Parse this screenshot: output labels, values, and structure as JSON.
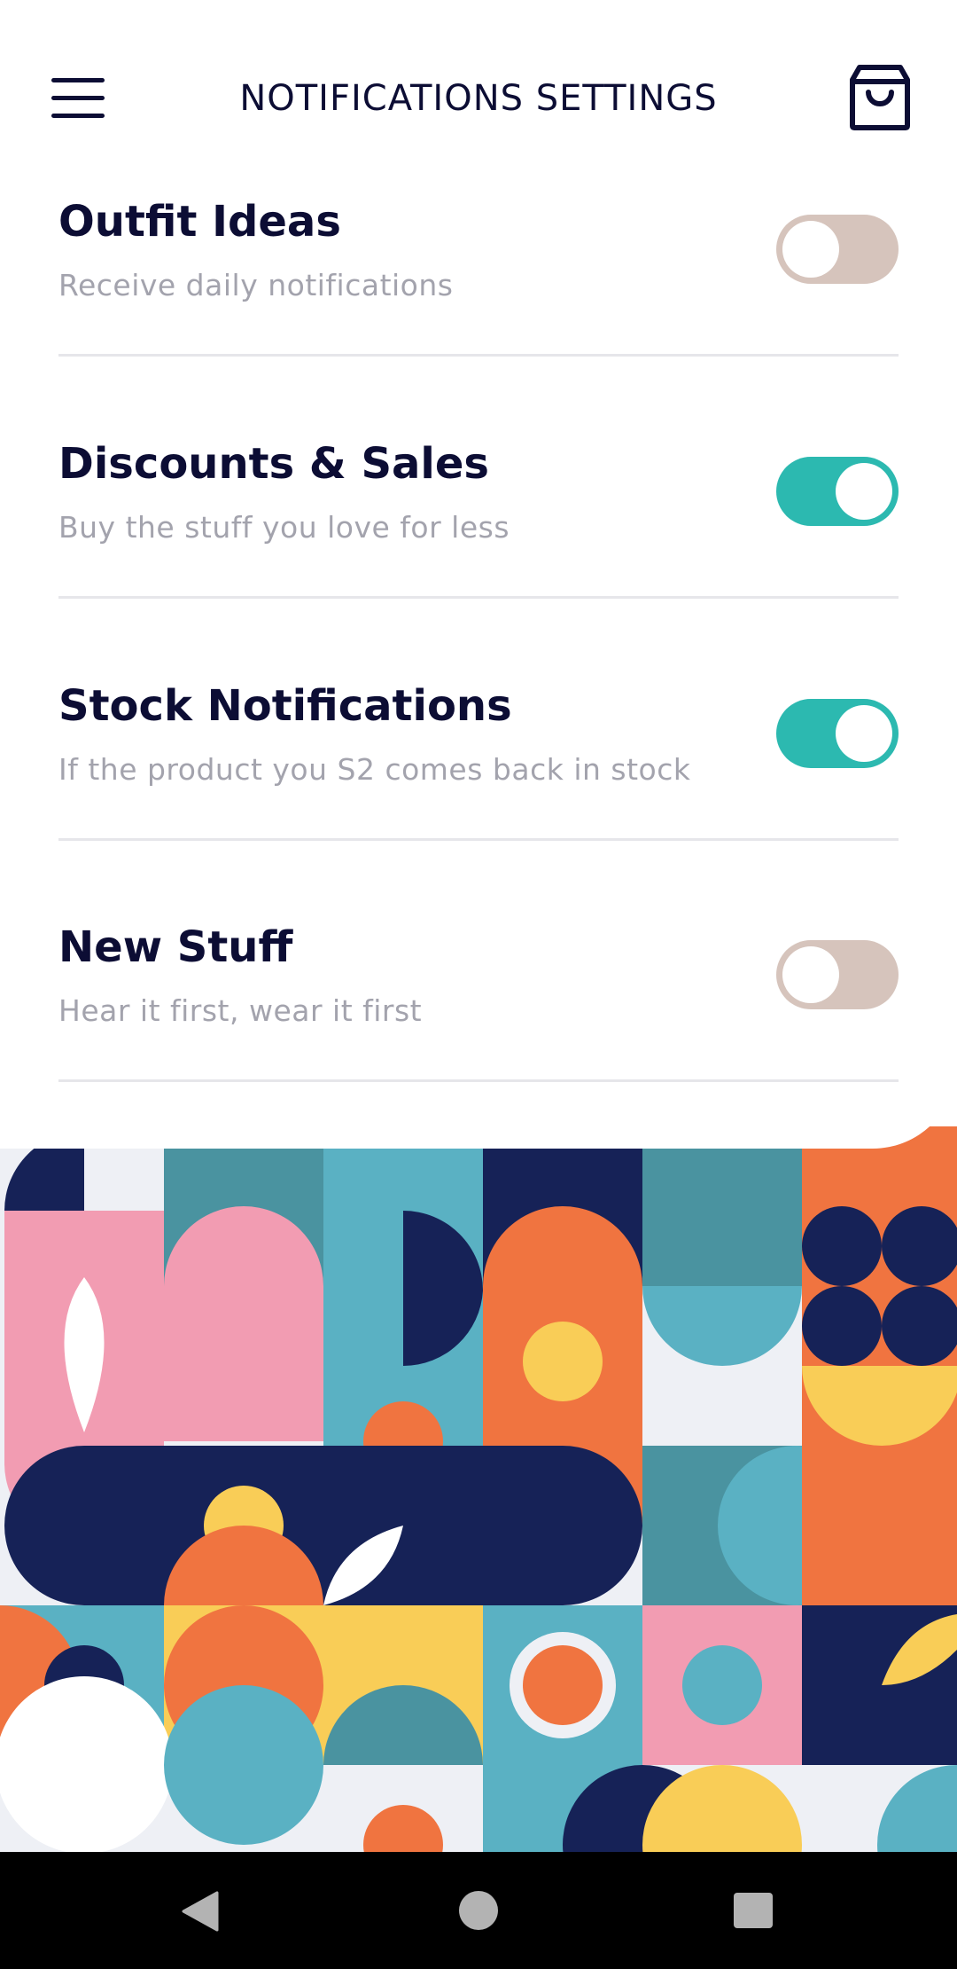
{
  "header": {
    "title": "NOTIFICATIONS SETTINGS",
    "menu_icon": "hamburger-menu-icon",
    "cart_icon": "shopping-bag-icon"
  },
  "settings": [
    {
      "name": "Outfit Ideas",
      "description": "Receive daily notifications",
      "enabled": false
    },
    {
      "name": "Discounts & Sales",
      "description": "Buy the stuff you love for less",
      "enabled": true
    },
    {
      "name": "Stock Notifications",
      "description": "If the product you S2 comes back in stock",
      "enabled": true
    },
    {
      "name": "New Stuff",
      "description": "Hear it first, wear it first",
      "enabled": false
    }
  ],
  "colors": {
    "text_primary": "#0c0d34",
    "text_secondary": "#a3a3ad",
    "toggle_on": "#2cb9b0",
    "toggle_off": "#d6c4bc",
    "pattern_navy": "#162257",
    "pattern_teal": "#4a93a0",
    "pattern_light_teal": "#5ab1c3",
    "pattern_pink": "#f29cb2",
    "pattern_orange": "#f07440",
    "pattern_yellow": "#f9cd57",
    "pattern_pale": "#eef0f5"
  },
  "navbar": {
    "back_icon": "back-triangle-icon",
    "home_icon": "home-circle-icon",
    "recents_icon": "recents-square-icon"
  }
}
